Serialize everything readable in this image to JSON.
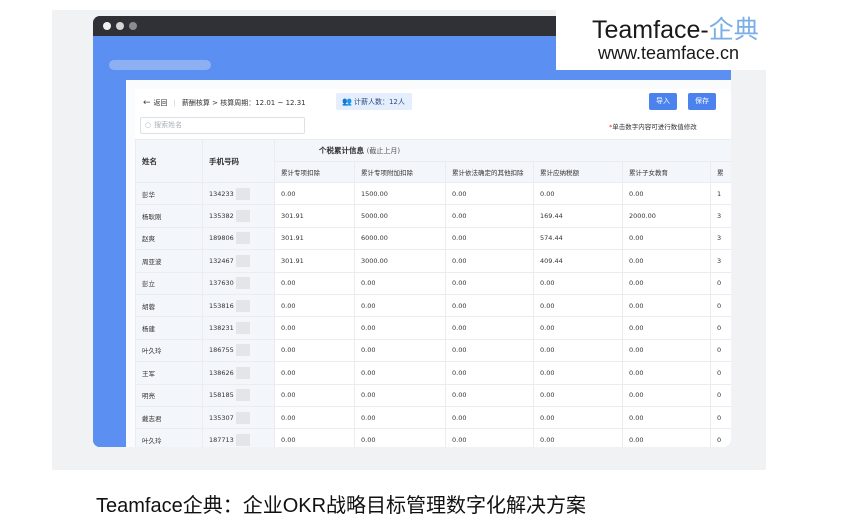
{
  "brand": {
    "name": "Teamface-",
    "name_cn": "企典",
    "url": "www.teamface.cn"
  },
  "caption": "Teamface企典：企业OKR战略目标管理数字化解决方案",
  "breadcrumb": {
    "back": "返回",
    "path": "薪酬核算 > 核算周期：12.01 ~ 12.31"
  },
  "count_badge": "计薪人数：12人",
  "buttons": {
    "import": "导入",
    "save": "保存"
  },
  "search": {
    "placeholder": "搜索姓名"
  },
  "hint": {
    "star": "*",
    "text": "单击数字内容可进行数值修改"
  },
  "table": {
    "col_name": "姓名",
    "col_phone": "手机号码",
    "group_title": "个税累计信息",
    "group_sub": "(截止上月)",
    "sub_headers": [
      "累计专项扣除",
      "累计专项附加扣除",
      "累计依法确定的其他扣除",
      "累计应纳税额",
      "累计子女教育",
      "累"
    ],
    "rows": [
      {
        "name": "彭华",
        "phone": "134233",
        "vals": [
          "0.00",
          "1500.00",
          "0.00",
          "0.00",
          "0.00",
          "1"
        ]
      },
      {
        "name": "杨耿刚",
        "phone": "135382",
        "vals": [
          "301.91",
          "5000.00",
          "0.00",
          "169.44",
          "2000.00",
          "3"
        ]
      },
      {
        "name": "赵爽",
        "phone": "189806",
        "vals": [
          "301.91",
          "6000.00",
          "0.00",
          "574.44",
          "0.00",
          "3"
        ]
      },
      {
        "name": "周亚波",
        "phone": "132467",
        "vals": [
          "301.91",
          "3000.00",
          "0.00",
          "409.44",
          "0.00",
          "3"
        ]
      },
      {
        "name": "彭立",
        "phone": "137630",
        "vals": [
          "0.00",
          "0.00",
          "0.00",
          "0.00",
          "0.00",
          "0"
        ]
      },
      {
        "name": "胡蓉",
        "phone": "153816",
        "vals": [
          "0.00",
          "0.00",
          "0.00",
          "0.00",
          "0.00",
          "0"
        ]
      },
      {
        "name": "杨建",
        "phone": "138231",
        "vals": [
          "0.00",
          "0.00",
          "0.00",
          "0.00",
          "0.00",
          "0"
        ]
      },
      {
        "name": "叶久玲",
        "phone": "186755",
        "vals": [
          "0.00",
          "0.00",
          "0.00",
          "0.00",
          "0.00",
          "0"
        ]
      },
      {
        "name": "王军",
        "phone": "138626",
        "vals": [
          "0.00",
          "0.00",
          "0.00",
          "0.00",
          "0.00",
          "0"
        ]
      },
      {
        "name": "明亮",
        "phone": "158185",
        "vals": [
          "0.00",
          "0.00",
          "0.00",
          "0.00",
          "0.00",
          "0"
        ]
      },
      {
        "name": "戴志君",
        "phone": "135307",
        "vals": [
          "0.00",
          "0.00",
          "0.00",
          "0.00",
          "0.00",
          "0"
        ]
      },
      {
        "name": "叶久玲",
        "phone": "187713",
        "vals": [
          "0.00",
          "0.00",
          "0.00",
          "0.00",
          "0.00",
          "0"
        ]
      }
    ]
  },
  "icons": {
    "back": "back-arrow-icon",
    "user": "user-group-icon",
    "search": "search-icon"
  },
  "colors": {
    "accent": "#4c82ee",
    "frame": "#5b8ff2",
    "brand_cn": "#7aaee6",
    "required": "#e53935"
  }
}
